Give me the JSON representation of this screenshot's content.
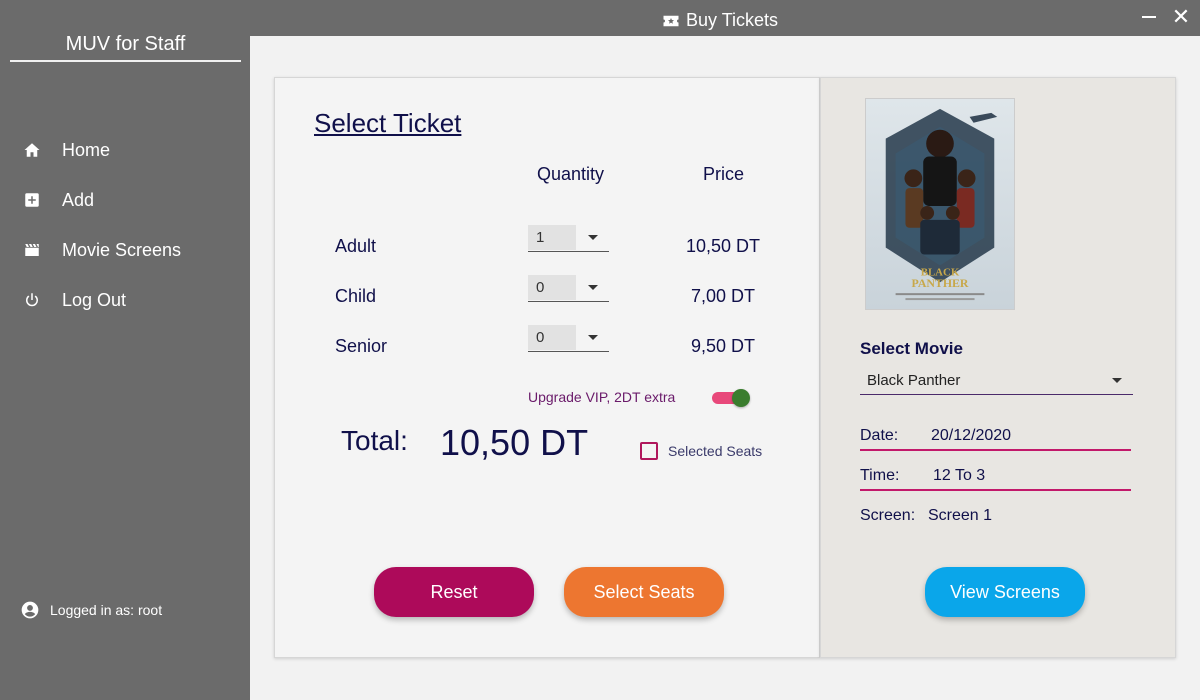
{
  "window": {
    "title": "Buy Tickets",
    "close_glyph": "✕"
  },
  "sidebar": {
    "app_title": "MUV for Staff",
    "items": [
      {
        "label": "Home",
        "icon": "home-icon"
      },
      {
        "label": "Add",
        "icon": "plus-square-icon"
      },
      {
        "label": "Movie Screens",
        "icon": "clapperboard-icon"
      },
      {
        "label": "Log Out",
        "icon": "power-icon"
      }
    ],
    "logged_in": "Logged in as: root"
  },
  "ticket": {
    "heading": "Select Ticket",
    "quantity_header": "Quantity",
    "price_header": "Price",
    "rows": [
      {
        "label": "Adult",
        "quantity": "1",
        "price": "10,50 DT"
      },
      {
        "label": "Child",
        "quantity": "0",
        "price": "7,00 DT"
      },
      {
        "label": "Senior",
        "quantity": "0",
        "price": "9,50 DT"
      }
    ],
    "vip_label": "Upgrade VIP, 2DT extra",
    "vip_enabled": true,
    "total_label": "Total:",
    "total_value": "10,50 DT",
    "selected_seats_label": "Selected Seats",
    "selected_seats_checked": false,
    "reset_label": "Reset",
    "select_seats_label": "Select Seats"
  },
  "movie": {
    "poster_title_line1": "BLACK",
    "poster_title_line2": "PANTHER",
    "select_label": "Select Movie",
    "selected": "Black Panther",
    "date_label": "Date:",
    "date_value": "20/12/2020",
    "time_label": "Time:",
    "time_value": "12 To 3",
    "screen_label": "Screen:",
    "screen_value": "Screen 1",
    "view_screens_label": "View Screens"
  },
  "colors": {
    "sidebar": "#6b6b6b",
    "reset": "#ad0a5a",
    "select_seats": "#ed7630",
    "view_screens": "#0aa6ea",
    "accent_line": "#c2186a"
  }
}
